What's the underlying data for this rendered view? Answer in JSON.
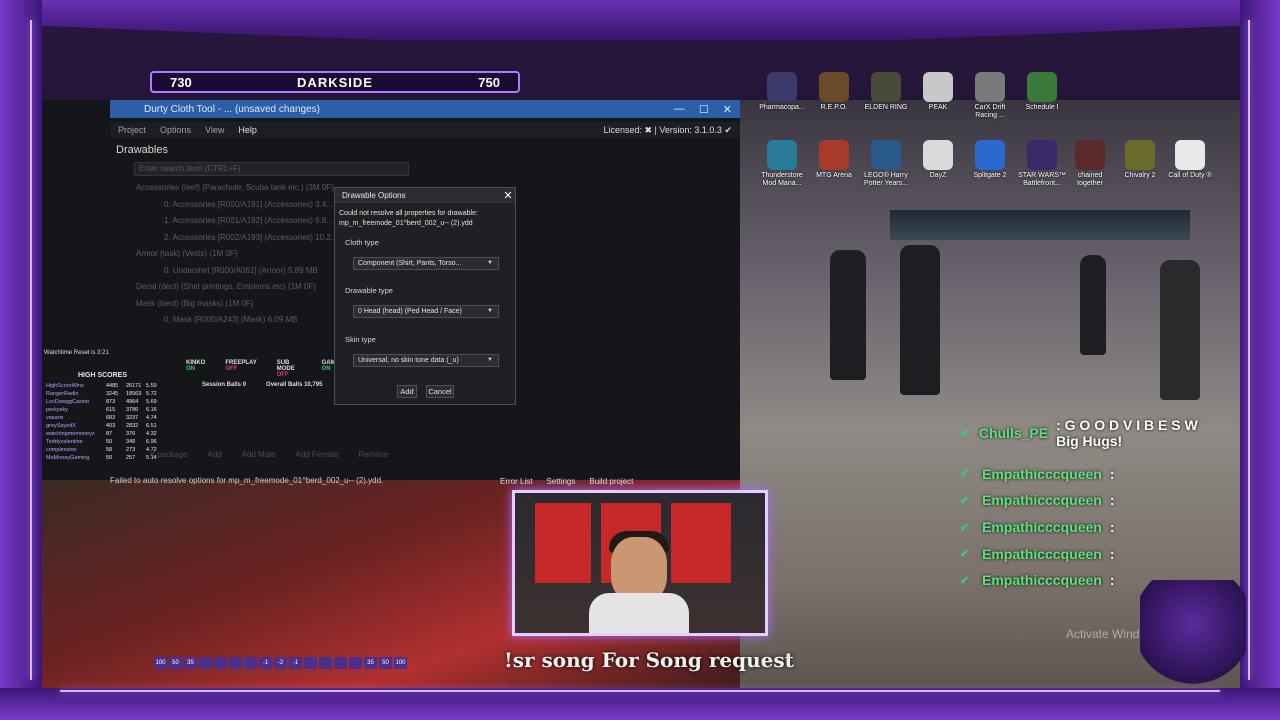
{
  "scoreboard": {
    "left_score": "730",
    "title": "DARKSIDE",
    "right_score": "750"
  },
  "app": {
    "title": "Durty Cloth Tool - ... (unsaved changes)",
    "menu": [
      "Project",
      "Options",
      "View"
    ],
    "help": "Help",
    "license": "Licensed:",
    "version": "Version: 3.1.0.3",
    "panel_title": "Drawables",
    "search_placeholder": "Enter search term (CTRL+F)",
    "tree": [
      "Accessories (teef) (Parachute, Scuba tank etc.) (3M 0F)",
      "0. Accessories [R000/A191] (Accessories) 3.4...",
      "1. Accessories [R001/A192] (Accessories) 6.8...",
      "2. Accessories [R002/A193] (Accessories) 10.2...",
      "Armor (task) (Vests) (1M 0F)",
      "0. Undershirt [R000/A061] (Armor) 5.89 MB",
      "Decal (decl) (Shirt printings, Emblems etc) (1M 0F)",
      "Mask (berd) (Big masks) (1M 0F)",
      "0. Mask [R000/A243] (Mask) 6.09 MB"
    ],
    "bottom_buttons": [
      "rt package",
      "Add",
      "Add Male",
      "Add Female",
      "Remove"
    ],
    "status": "Failed to auto resolve options for mp_m_freemode_01^berd_002_u-- (2).ydd.",
    "footer": [
      "Error List",
      "Settings",
      "Build project"
    ]
  },
  "dialog": {
    "title": "Drawable Options",
    "message_line1": "Could not resolve all properties for drawable:",
    "message_line2": "mp_m_freemode_01^berd_002_u-- (2).ydd",
    "cloth_label": "Cloth type",
    "cloth_value": "Component (Shirt, Pants, Torso...",
    "drawable_label": "Drawable type",
    "drawable_value": "0    Head (head) (Ped Head / Face)",
    "skin_label": "Skin type",
    "skin_value": "Universal, no skin tone data (_u)",
    "add": "Add",
    "cancel": "Cancel"
  },
  "stream": {
    "watchtime": "Watchtime Reset is 3:21",
    "kinko": "KINKO",
    "kinko_state": "ON",
    "freeplay": "FREEPLAY",
    "freeplay_state": "OFF",
    "submode": "SUB MODE",
    "submode_state": "OFF",
    "gamba": "GAMBA",
    "gamba_state": "ON",
    "session_balls": "Session Balls",
    "session_val": "0",
    "overall_balls": "Overall Balls",
    "overall_val": "10,795",
    "high_scores_title": "HIGH SCORES",
    "high_scores": [
      [
        "HighScoreWins",
        "4485",
        "26171",
        "5.59"
      ],
      [
        "RangerRadio",
        "3245",
        "18563",
        "5.72"
      ],
      [
        "LocDawggCasino",
        "873",
        "4964",
        "5.69"
      ],
      [
        "perkyeky",
        "615",
        "3786",
        "6.16"
      ],
      [
        "vasaris",
        "683",
        "3237",
        "4.74"
      ],
      [
        "greySayedX",
        "403",
        "2832",
        "6.51"
      ],
      [
        "watchingmemoneyz",
        "87",
        "376",
        "4.32"
      ],
      [
        "Teddyvalentine",
        "50",
        "348",
        "6.96"
      ],
      [
        "complexsino",
        "58",
        "273",
        "4.72"
      ],
      [
        "MoMoneyGaming",
        "50",
        "257",
        "5.14"
      ]
    ],
    "song_text": "!sr song For Song request",
    "watermark": "Activate Windo"
  },
  "desktop_icons": [
    {
      "label": "Pharmacopa...",
      "color": "#3b3b6b"
    },
    {
      "label": "R.E.P.O.",
      "color": "#6b4a2a"
    },
    {
      "label": "ELDEN RING",
      "color": "#4a4a3a"
    },
    {
      "label": "PEAK",
      "color": "#c8c8c8"
    },
    {
      "label": "CarX Drift Racing ...",
      "color": "#7a7a7a"
    },
    {
      "label": "Schedule I",
      "color": "#3a7a3a"
    },
    {
      "label": "Thunderstore Mod Mana...",
      "color": "#2a7a9a"
    },
    {
      "label": "MTG Arena",
      "color": "#a83a2a"
    },
    {
      "label": "LEGO® Harry Potter Years...",
      "color": "#2a5a8a"
    },
    {
      "label": "DayZ",
      "color": "#dadada"
    },
    {
      "label": "Splitgate 2",
      "color": "#2a6ad0"
    },
    {
      "label": "STAR WARS™ Battlefront...",
      "color": "#3a2a6a"
    },
    {
      "label": "chained together",
      "color": "#5a2a2a"
    },
    {
      "label": "Chivalry 2",
      "color": "#6a6a2a"
    },
    {
      "label": "Call of Duty ®",
      "color": "#e8e8e8"
    }
  ],
  "chat": [
    {
      "name": "Chulls_PE",
      "text": ": G O O D V I B E S   W Big Hugs!"
    },
    {
      "name": "Empathicccqueen",
      "text": ":"
    },
    {
      "name": "Empathicccqueen",
      "text": ":"
    },
    {
      "name": "Empathicccqueen",
      "text": ":"
    },
    {
      "name": "Empathicccqueen",
      "text": ":"
    },
    {
      "name": "Empathicccqueen",
      "text": ":"
    }
  ],
  "hud_numbers": [
    "100",
    "50",
    "35",
    "",
    "",
    "",
    "",
    "-1",
    "-2",
    "-1",
    "",
    "",
    "",
    "",
    "35",
    "50",
    "100"
  ],
  "colors": {
    "accent": "#7a39c9",
    "chat_name": "#5fe07b",
    "title_bar": "#2c5fa8"
  }
}
